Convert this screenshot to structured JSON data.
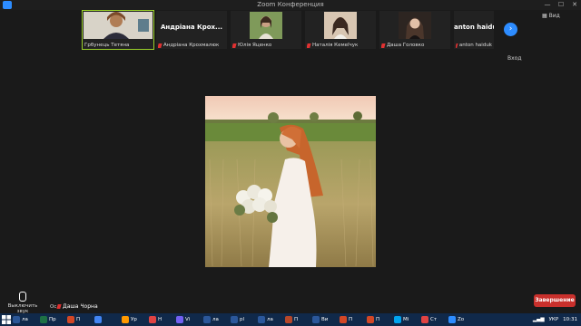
{
  "window": {
    "title": "Zoom Конференция",
    "minimize": "—",
    "maximize": "☐",
    "close": "✕"
  },
  "participants": [
    {
      "name": "Грбунець Тетяна",
      "display": "",
      "active": true,
      "muted": false,
      "thumb_color": "#8a6e5b"
    },
    {
      "name": "Андріана Крохмалюк",
      "display": "Андріана Крох...",
      "active": false,
      "muted": true
    },
    {
      "name": "Юлія Яценко",
      "display": "",
      "active": false,
      "muted": true,
      "thumb_color": "#6f8a54"
    },
    {
      "name": "Наталія Кемеїчук",
      "display": "",
      "active": false,
      "muted": true,
      "thumb_color": "#c2aa93"
    },
    {
      "name": "Даша Головко",
      "display": "",
      "active": false,
      "muted": true,
      "thumb_color": "#4a3a32"
    },
    {
      "name": "anton haiduk",
      "display": "anton haiduk",
      "active": false,
      "muted": true
    }
  ],
  "controls": {
    "view_label": "Вид",
    "exit_label": "Вход",
    "mute_label": "Выключить звук",
    "stop_label": "Ос",
    "end_label": "Завершение"
  },
  "speaker": {
    "name": "Даша Чорна"
  },
  "taskbar": {
    "items": [
      {
        "label": "ла",
        "color": "#2b5797"
      },
      {
        "label": "Пр",
        "color": "#1e7145"
      },
      {
        "label": "П",
        "color": "#d24726"
      },
      {
        "label": "",
        "color": "#4285f4"
      },
      {
        "label": "Ур",
        "color": "#ff9900"
      },
      {
        "label": "Н",
        "color": "#e04343"
      },
      {
        "label": "Vi",
        "color": "#7360f2"
      },
      {
        "label": "ла",
        "color": "#2b579a"
      },
      {
        "label": "pl",
        "color": "#2b579a"
      },
      {
        "label": "ла",
        "color": "#2b579a"
      },
      {
        "label": "П",
        "color": "#b7472a"
      },
      {
        "label": "Ви",
        "color": "#2b579a"
      },
      {
        "label": "П",
        "color": "#d24726"
      },
      {
        "label": "П",
        "color": "#d24726"
      },
      {
        "label": "Mi",
        "color": "#00a4ef"
      },
      {
        "label": "Ст",
        "color": "#e04343"
      },
      {
        "label": "Zo",
        "color": "#2d8cff"
      }
    ],
    "lang": "УКР",
    "time": "10:31"
  }
}
